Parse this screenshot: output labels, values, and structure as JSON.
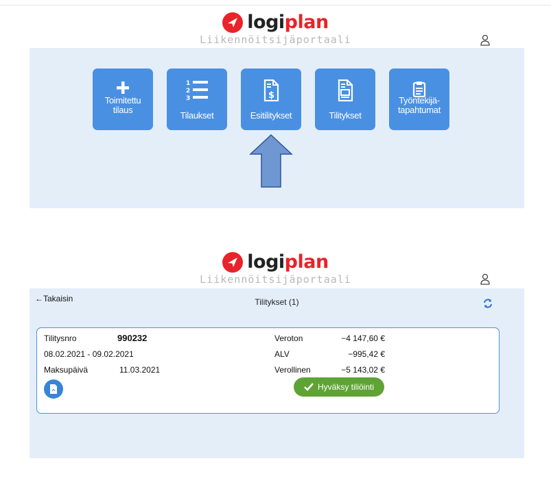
{
  "header": {
    "logo_part1": "logi",
    "logo_part2": "plan",
    "subtitle": "Liikennöitsijäportaali"
  },
  "menu": {
    "tiles": [
      {
        "line1": "Toimitettu",
        "line2": "tilaus",
        "icon": "plus-icon"
      },
      {
        "line1": "Tilaukset",
        "line2": "",
        "icon": "numbered-list-icon"
      },
      {
        "line1": "Esitilitykset",
        "line2": "",
        "icon": "invoice-dollar-icon"
      },
      {
        "line1": "Tilitykset",
        "line2": "",
        "icon": "document-icon"
      },
      {
        "line1": "Työntekijä-",
        "line2": "tapahtumat",
        "icon": "clipboard-icon"
      }
    ]
  },
  "settlements": {
    "back_label": "←Takaisin",
    "title": "Tilitykset (1)",
    "card": {
      "number_label": "Tilitysnro",
      "number_value": "990232",
      "period": "08.02.2021 - 09.02.2021",
      "payday_label": "Maksupäivä",
      "payday_value": "11.03.2021",
      "net_label": "Veroton",
      "net_value": "−4 147,60 €",
      "vat_label": "ALV",
      "vat_value": "−995,42 €",
      "gross_label": "Verollinen",
      "gross_value": "−5 143,02 €",
      "approve_label": "Hyväksy tiliöinti"
    }
  },
  "colors": {
    "accent": "#4a90e2",
    "panel_bg": "#e4eef9",
    "brand_red": "#e8232a",
    "approve_green": "#5fa335",
    "arrow_fill": "#6f97d2"
  }
}
